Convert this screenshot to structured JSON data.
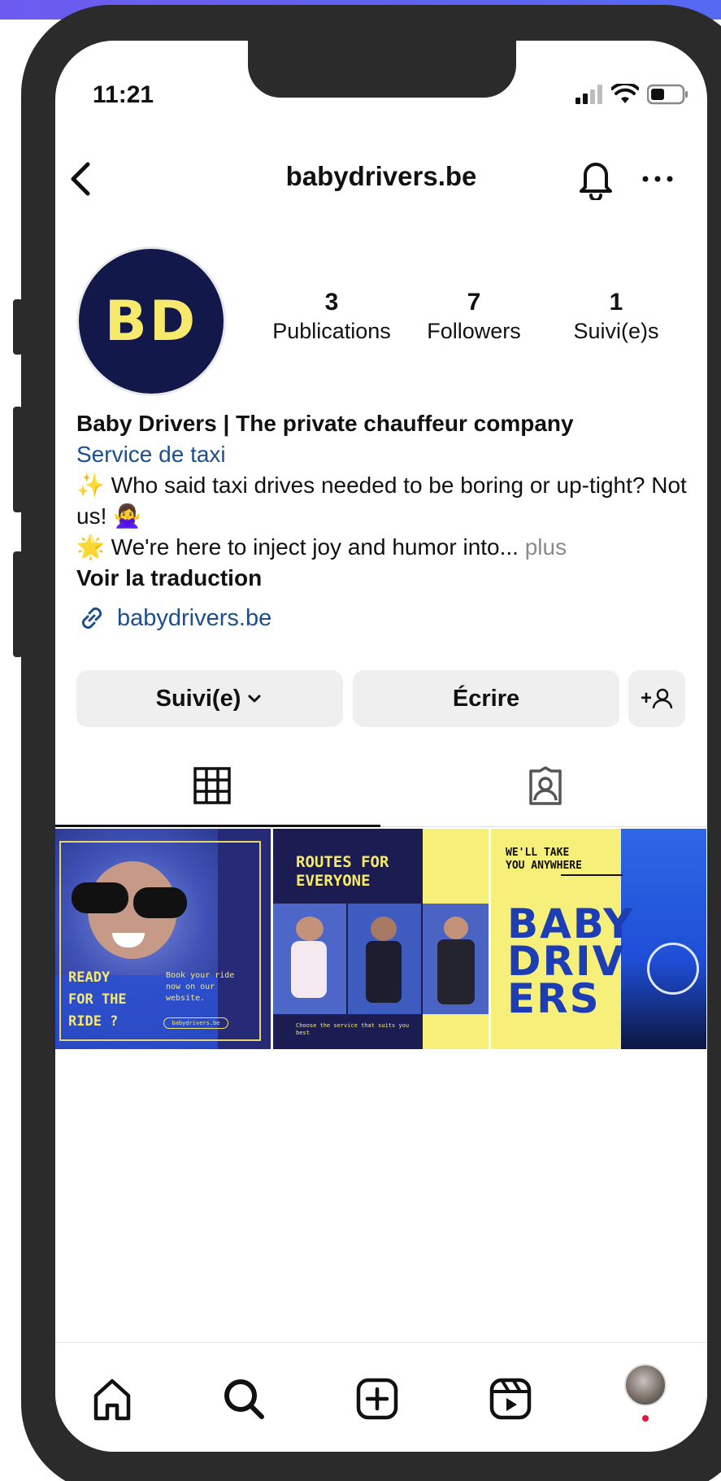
{
  "status_bar": {
    "time": "11:21"
  },
  "header": {
    "username": "babydrivers.be"
  },
  "profile": {
    "avatar_text": "BD",
    "stats": [
      {
        "value": "3",
        "label": "Publications"
      },
      {
        "value": "7",
        "label": "Followers"
      },
      {
        "value": "1",
        "label": "Suivi(e)s"
      }
    ],
    "name": "Baby Drivers | The private chauffeur company",
    "category": "Service de taxi",
    "bio_line1": "✨ Who said taxi drives needed to be boring or up-tight? Not us! 🙅‍♀️",
    "bio_line2": "🌟 We're here to inject joy and humor into...",
    "bio_more": "plus",
    "see_translation": "Voir la traduction",
    "website": "babydrivers.be"
  },
  "actions": {
    "following_label": "Suivi(e)",
    "message_label": "Écrire",
    "add_person_label": "+"
  },
  "posts": [
    {
      "title": "READY\nFOR THE\nRIDE ?",
      "subtitle": "Book your ride now on our website.",
      "link": "babydrivers.be"
    },
    {
      "title": "ROUTES FOR\nEVERYONE",
      "caption": "Choose the service that suits you best"
    },
    {
      "tagline": "WE'LL TAKE\nYOU ANYWHERE",
      "big": "BABY\nDRIV\nERS"
    }
  ],
  "colors": {
    "accent_link": "#1d4f8c",
    "brand_navy": "#13184a",
    "brand_yellow": "#f6e96b",
    "button_bg": "#efefef",
    "notification_dot": "#e3163a"
  },
  "icons": {
    "back": "chevron-left-icon",
    "notifications": "bell-icon",
    "more": "more-horizontal-icon",
    "link": "link-icon",
    "grid_tab": "grid-icon",
    "tagged_tab": "tagged-person-icon",
    "home": "home-icon",
    "search": "search-icon",
    "create": "plus-square-icon",
    "reels": "reels-icon"
  }
}
